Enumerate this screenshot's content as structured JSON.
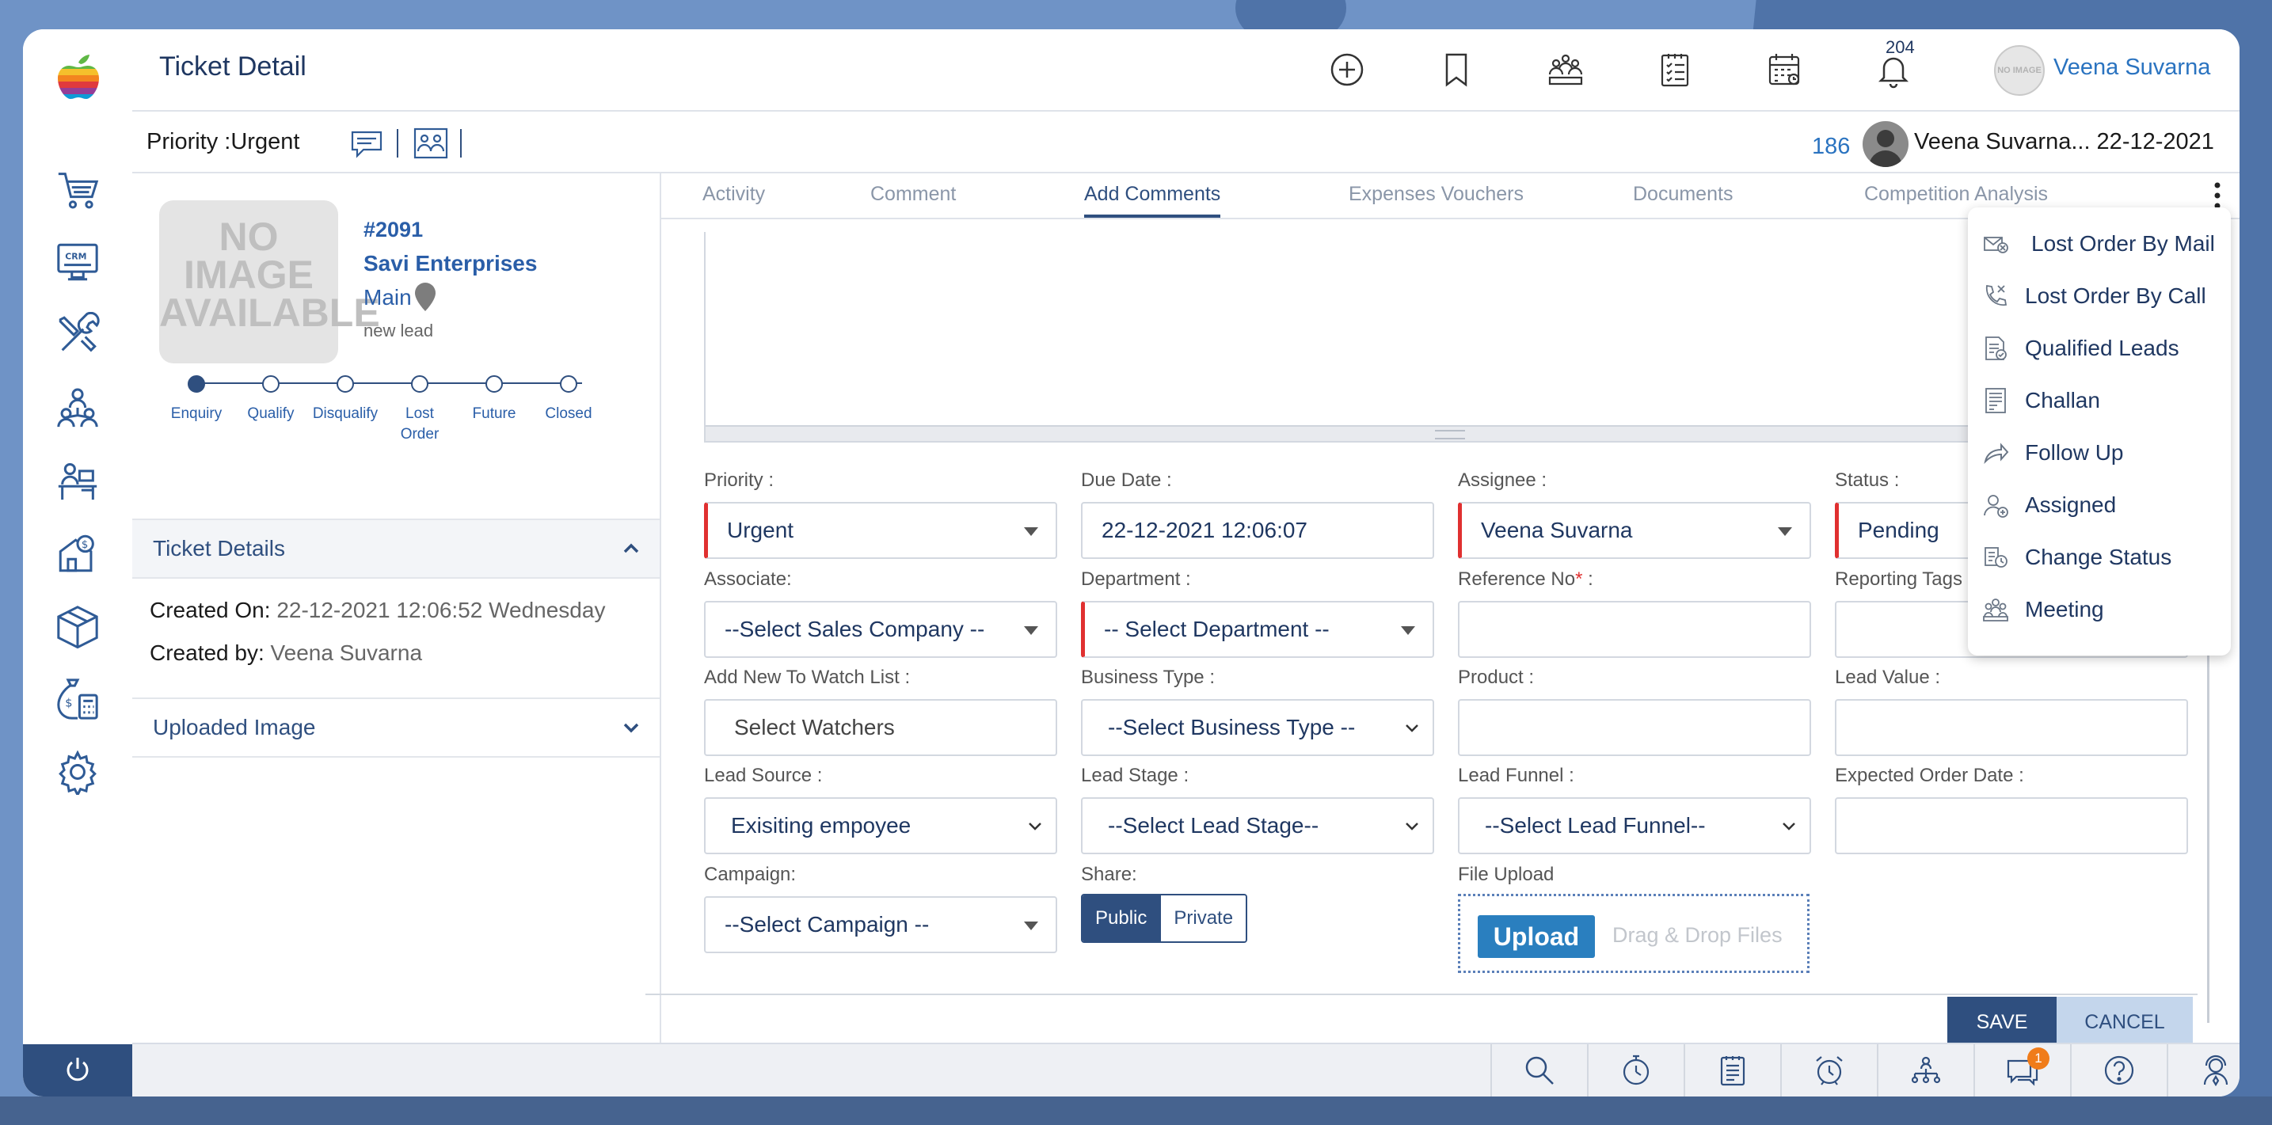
{
  "header": {
    "title": "Ticket Detail",
    "notification_count": "204",
    "user_name": "Veena Suvarna",
    "avatar_text": "NO IMAGE"
  },
  "subheader": {
    "priority_text": "Priority :Urgent",
    "count": "186",
    "user_date": "Veena Suvarna... 22-12-2021"
  },
  "ticket": {
    "no_image": "NO IMAGE AVAILABLE",
    "number": "#2091",
    "company": "Savi Enterprises",
    "branch": "Main",
    "lead_state": "new lead",
    "stages": [
      "Enquiry",
      "Qualify",
      "Disqualify",
      "Lost Order",
      "Future",
      "Closed"
    ]
  },
  "details": {
    "section_title": "Ticket Details",
    "created_on_label": "Created On:",
    "created_on_value": "22-12-2021 12:06:52 Wednesday",
    "created_by_label": "Created by:",
    "created_by_value": "Veena Suvarna",
    "uploaded_title": "Uploaded Image"
  },
  "tabs": [
    "Activity",
    "Comment",
    "Add Comments",
    "Expenses Vouchers",
    "Documents",
    "Competition Analysis"
  ],
  "active_tab": "Add Comments",
  "form": {
    "priority_label": "Priority :",
    "priority_value": "Urgent",
    "due_label": "Due Date :",
    "due_value": "22-12-2021 12:06:07",
    "assignee_label": "Assignee :",
    "assignee_value": "Veena Suvarna",
    "status_label": "Status :",
    "status_value": "Pending",
    "associate_label": "Associate:",
    "associate_value": "--Select Sales Company --",
    "department_label": "Department :",
    "department_value": "-- Select Department --",
    "reference_label": "Reference No",
    "reference_required": "*",
    "reference_colon": " :",
    "reporting_label": "Reporting Tags",
    "watch_label": "Add New To Watch List :",
    "watch_value": "Select Watchers",
    "business_label": "Business Type :",
    "business_value": "--Select Business Type --",
    "product_label": "Product :",
    "leadvalue_label": "Lead Value :",
    "source_label": "Lead Source :",
    "source_value": "Exisiting empoyee",
    "stage_label": "Lead Stage :",
    "stage_value": "--Select Lead Stage--",
    "funnel_label": "Lead Funnel :",
    "funnel_value": "--Select Lead Funnel--",
    "expected_label": "Expected Order Date :",
    "campaign_label": "Campaign:",
    "campaign_value": "--Select Campaign --",
    "share_label": "Share:",
    "share_public": "Public",
    "share_private": "Private",
    "file_label": "File Upload",
    "upload_button": "Upload",
    "drop_text": "Drag & Drop Files"
  },
  "actions": {
    "save": "SAVE",
    "cancel": "CANCEL"
  },
  "menu": {
    "items": [
      {
        "label": "Lost Order By Mail",
        "icon": "mail-icon"
      },
      {
        "label": "Lost Order By Call",
        "icon": "phone-icon"
      },
      {
        "label": "Qualified Leads",
        "icon": "document-check-icon"
      },
      {
        "label": "Challan",
        "icon": "receipt-icon"
      },
      {
        "label": "Follow Up",
        "icon": "share-arrow-icon"
      },
      {
        "label": "Assigned",
        "icon": "user-assign-icon"
      },
      {
        "label": "Change Status",
        "icon": "status-icon"
      },
      {
        "label": "Meeting",
        "icon": "meeting-icon"
      }
    ]
  },
  "footer": {
    "chat_badge": "1"
  },
  "colors": {
    "primary": "#2f4f7f",
    "accent": "#2a73c0",
    "required": "#e03030",
    "badge": "#f07c1a"
  }
}
